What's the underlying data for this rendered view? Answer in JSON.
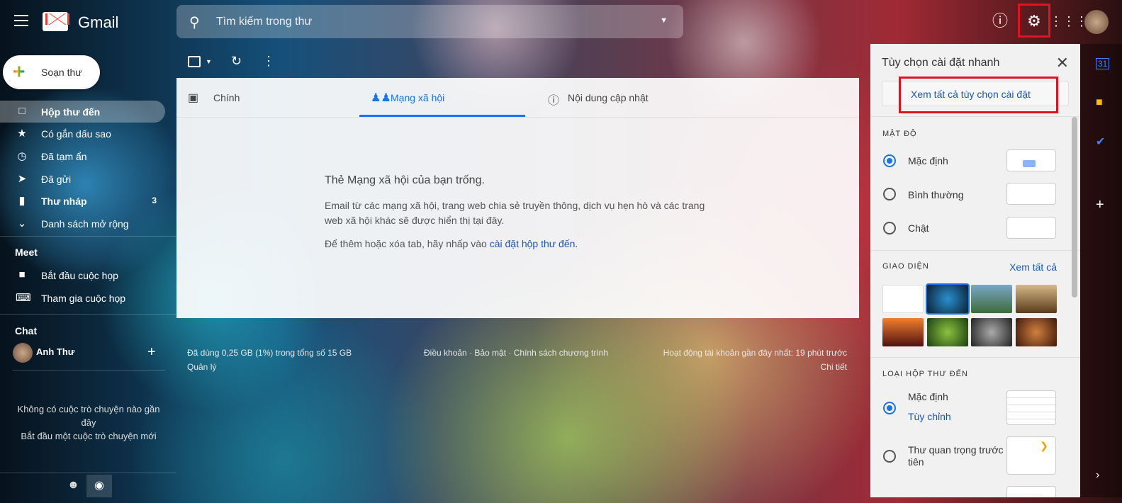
{
  "header": {
    "brand": "Gmail",
    "search_placeholder": "Tìm kiếm trong thư"
  },
  "compose": {
    "label": "Soạn thư"
  },
  "sidebar": {
    "items": [
      {
        "label": "Hộp thư đến",
        "icon": "inbox-icon",
        "count": ""
      },
      {
        "label": "Có gắn dấu sao",
        "icon": "star-icon",
        "count": ""
      },
      {
        "label": "Đã tạm ẩn",
        "icon": "clock-icon",
        "count": ""
      },
      {
        "label": "Đã gửi",
        "icon": "send-icon",
        "count": ""
      },
      {
        "label": "Thư nháp",
        "icon": "draft-icon",
        "count": "3"
      },
      {
        "label": "Danh sách mở rộng",
        "icon": "chevron-down-icon",
        "count": ""
      }
    ],
    "meet_title": "Meet",
    "meet_items": [
      {
        "label": "Bắt đầu cuộc họp"
      },
      {
        "label": "Tham gia cuộc họp"
      }
    ],
    "chat_title": "Chat",
    "chat_user": "Anh Thư",
    "chat_empty_1": "Không có cuộc trò chuyện nào gần đây",
    "chat_empty_2": "Bắt đầu một cuộc trò chuyện mới"
  },
  "tabs": [
    {
      "label": "Chính"
    },
    {
      "label": "Mạng xã hội"
    },
    {
      "label": "Nội dung cập nhật"
    }
  ],
  "empty": {
    "title": "Thẻ Mạng xã hội của bạn trống.",
    "body": "Email từ các mạng xã hội, trang web chia sẻ truyền thông, dịch vụ hẹn hò và các trang web xã hội khác sẽ được hiển thị tại đây.",
    "hint_prefix": "Để thêm hoặc xóa tab, hãy nhấp vào ",
    "hint_link": "cài đặt hộp thư đến",
    "hint_suffix": "."
  },
  "footer": {
    "storage": "Đã dùng 0,25 GB (1%) trong tổng số 15 GB",
    "manage": "Quản lý",
    "links": "Điều khoản · Bảo mật · Chính sách chương trình",
    "activity": "Hoạt động tài khoản gần đây nhất: 19 phút trước",
    "details": "Chi tiết"
  },
  "quick_settings": {
    "title": "Tùy chọn cài đặt nhanh",
    "see_all": "Xem tất cả tùy chọn cài đặt",
    "density_title": "MẬT ĐỘ",
    "density": [
      {
        "label": "Mặc định",
        "selected": true
      },
      {
        "label": "Bình thường",
        "selected": false
      },
      {
        "label": "Chật",
        "selected": false
      }
    ],
    "theme_title": "GIAO DIỆN",
    "theme_see_all": "Xem tất cả",
    "inbox_title": "LOẠI HỘP THƯ ĐẾN",
    "inbox_default": "Mặc định",
    "inbox_customize": "Tùy chỉnh",
    "inbox_important": "Thư quan trọng trước tiên"
  },
  "colors": {
    "accent": "#1a73e8",
    "highlight": "#e0141e"
  }
}
